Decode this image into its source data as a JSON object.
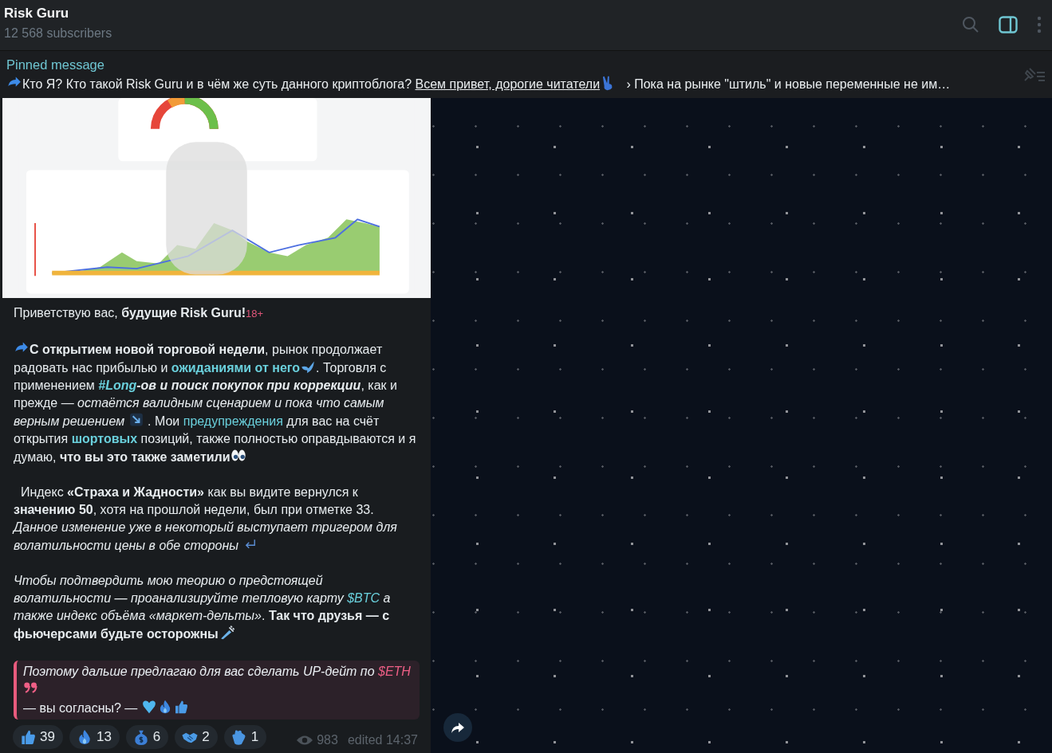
{
  "header": {
    "title": "Risk Guru",
    "subtitle": "12 568 subscribers",
    "sidebar_toggle": {
      "on": true
    }
  },
  "pinned": {
    "label": "Pinned message",
    "segments": [
      {
        "kind": "arrow"
      },
      {
        "kind": "text",
        "text": "Кто Я? Кто такой Risk Guru и в чём же суть данного криптоблога? "
      },
      {
        "kind": "link",
        "text": "Всем привет, дорогие читатели"
      },
      {
        "kind": "victory"
      },
      {
        "kind": "text",
        "text": "   › Пока на рынке \"штиль\" и новые переменные не им…"
      }
    ]
  },
  "message": {
    "paragraphs": [
      [
        {
          "kind": "text",
          "text": "Приветствую вас, **будущие Risk Guru!**"
        },
        {
          "kind": "tag",
          "text": "18+"
        }
      ],
      [
        {
          "kind": "arrow"
        },
        {
          "kind": "text",
          "text": "**С открытием новой торговой недели**, рынок продолжает радовать нас прибылью и "
        },
        {
          "kind": "link",
          "text": "**ожиданиями от него**"
        },
        {
          "kind": "dove"
        },
        {
          "kind": "text",
          "text": ". Торговля с применением "
        },
        {
          "kind": "hashtag",
          "text": "#Long"
        },
        {
          "kind": "emphasis",
          "text": "-ов и поиск покупок при коррекции"
        },
        {
          "kind": "text",
          "text": ", как и прежде — *остаётся валидным сценарием и пока что самым верным решением* "
        },
        {
          "kind": "down"
        },
        {
          "kind": "text",
          "text": " . Мои "
        },
        {
          "kind": "link",
          "text": "предупреждения"
        },
        {
          "kind": "text",
          "text": " для вас на счёт открытия "
        },
        {
          "kind": "link",
          "text": "**шортовых**"
        },
        {
          "kind": "text",
          "text": " позиций, также полностью оправдываются и я думаю, **что вы это также заметили**"
        },
        {
          "kind": "eyes"
        }
      ],
      [
        {
          "kind": "text",
          "text": "  Индекс **«Страха и Жадности»** как вы видите вернулся к **значению 50**, хотя на прошлой недели, был при отметке 33.\n*Данное изменение уже в некоторый выступает тригером для волатильности цены в обе стороны* "
        },
        {
          "kind": "return"
        }
      ],
      [
        {
          "kind": "text",
          "text": "*Чтобы подтвердить мою теорию о предстоящей волатильности — проанализируйте тепловую карту* "
        },
        {
          "kind": "link",
          "text": "*$BTC*"
        },
        {
          "kind": "text",
          "text": " *а также индекс объёма «маркет-дельты»*. **Так что друзья — с фьючерсами будьте осторожны**"
        },
        {
          "kind": "needle"
        }
      ]
    ],
    "quote": [
      {
        "kind": "text",
        "text": "*Поэтому дальше предлагаю для вас сделать UP-дейт по* "
      },
      {
        "kind": "link",
        "text": "*$ETH*"
      },
      {
        "kind": "quotemark"
      },
      {
        "kind": "text",
        "text": "\n— вы согласны? — "
      },
      {
        "kind": "heart"
      },
      {
        "kind": "flame"
      },
      {
        "kind": "thumbs"
      }
    ],
    "reactions": [
      {
        "kind": "thumbs",
        "count": "39"
      },
      {
        "kind": "flame",
        "count": "13"
      },
      {
        "kind": "moneybag",
        "count": "6"
      },
      {
        "kind": "handshake",
        "count": "2"
      },
      {
        "kind": "clap",
        "count": "1"
      }
    ],
    "views": "983",
    "edited": "edited 14:37"
  }
}
